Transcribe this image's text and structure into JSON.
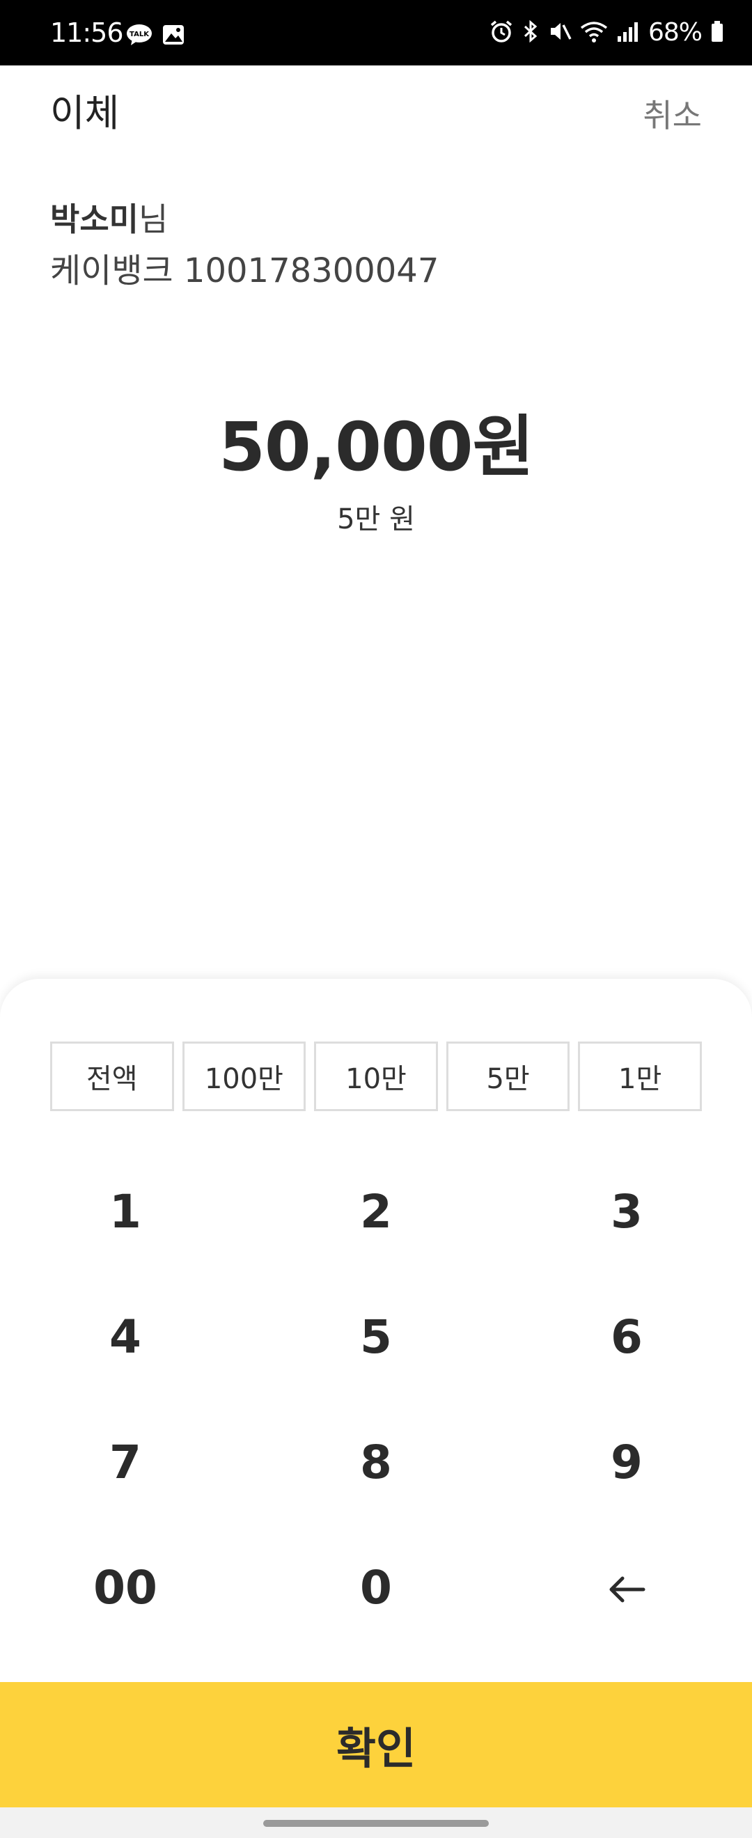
{
  "status_bar": {
    "time": "11:56",
    "battery": "68%",
    "left_icons": [
      "talk-icon",
      "gallery-icon"
    ],
    "right_icons": [
      "alarm-icon",
      "bluetooth-icon",
      "mute-icon",
      "wifi-icon",
      "signal-icon",
      "battery-icon"
    ]
  },
  "header": {
    "title": "이체",
    "cancel_label": "취소"
  },
  "recipient": {
    "name": "박소미",
    "honorific": "님",
    "bank": "케이뱅크",
    "account_number": "100178300047"
  },
  "amount": {
    "value": "50,000원",
    "korean": "5만 원"
  },
  "quick_amounts": [
    "전액",
    "100만",
    "10만",
    "5만",
    "1만"
  ],
  "keypad": {
    "keys": [
      "1",
      "2",
      "3",
      "4",
      "5",
      "6",
      "7",
      "8",
      "9",
      "00",
      "0"
    ],
    "backspace_icon": "arrow-left-icon"
  },
  "confirm_label": "확인",
  "colors": {
    "accent": "#fdd23c",
    "text": "#2b2b2b",
    "muted": "#777777"
  }
}
